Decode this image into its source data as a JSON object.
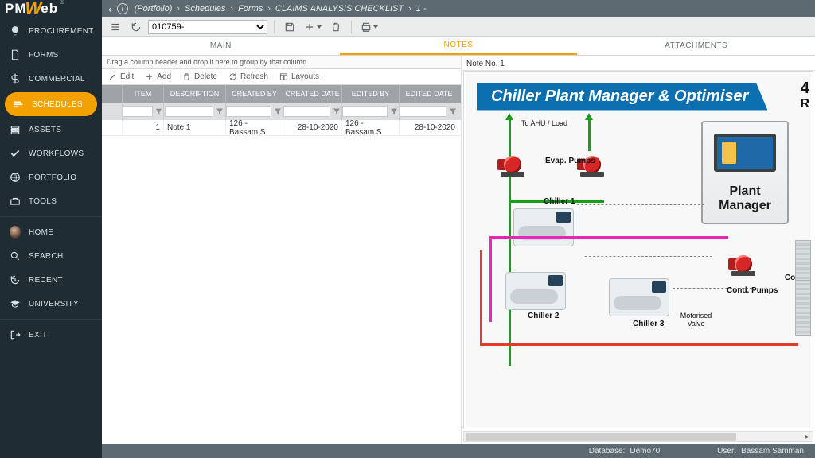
{
  "logo": {
    "pm": "PM",
    "w": "W",
    "eb": "eb",
    "reg": "®"
  },
  "breadcrumb": {
    "segments": [
      "(Portfolio)",
      "Schedules",
      "Forms",
      "CLAIMS ANALYSIS CHECKLIST",
      "1 -"
    ]
  },
  "toolbar": {
    "record_value": "010759-"
  },
  "sidebar": {
    "items": [
      {
        "label": "PROCUREMENT"
      },
      {
        "label": "FORMS"
      },
      {
        "label": "COMMERCIAL"
      },
      {
        "label": "SCHEDULES"
      },
      {
        "label": "ASSETS"
      },
      {
        "label": "WORKFLOWS"
      },
      {
        "label": "PORTFOLIO"
      },
      {
        "label": "TOOLS"
      }
    ],
    "lower": [
      {
        "label": "HOME"
      },
      {
        "label": "SEARCH"
      },
      {
        "label": "RECENT"
      },
      {
        "label": "UNIVERSITY"
      },
      {
        "label": "EXIT"
      }
    ]
  },
  "tabs": {
    "main": "MAIN",
    "notes": "NOTES",
    "attachments": "ATTACHMENTS"
  },
  "grid": {
    "group_hint": "Drag a column header and drop it here to group by that column",
    "buttons": {
      "edit": "Edit",
      "add": "Add",
      "delete": "Delete",
      "refresh": "Refresh",
      "layouts": "Layouts"
    },
    "headers": {
      "item": "ITEM",
      "description": "DESCRIPTION",
      "created_by": "CREATED BY",
      "created_date": "CREATED DATE",
      "edited_by": "EDITED BY",
      "edited_date": "EDITED DATE"
    },
    "rows": [
      {
        "item": "1",
        "description": "Note 1",
        "created_by": "126 - Bassam.S",
        "created_date": "28-10-2020",
        "edited_by": "126 - Bassam.S",
        "edited_date": "28-10-2020"
      }
    ]
  },
  "note": {
    "label": "Note No. 1",
    "diagram": {
      "title": "Chiller Plant Manager & Optimiser",
      "to_ahu": "To AHU / Load",
      "evap_pumps": "Evap. Pumps",
      "chiller1": "Chiller 1",
      "chiller2": "Chiller 2",
      "chiller3": "Chiller 3",
      "motorised_valve": "Motorised Valve",
      "cond_pumps": "Cond. Pumps",
      "cooling": "Coolin",
      "plant_manager": "Plant Manager",
      "rcut": "R"
    }
  },
  "status": {
    "db_label": "Database:",
    "db_value": "Demo70",
    "user_label": "User:",
    "user_value": "Bassam Samman"
  }
}
